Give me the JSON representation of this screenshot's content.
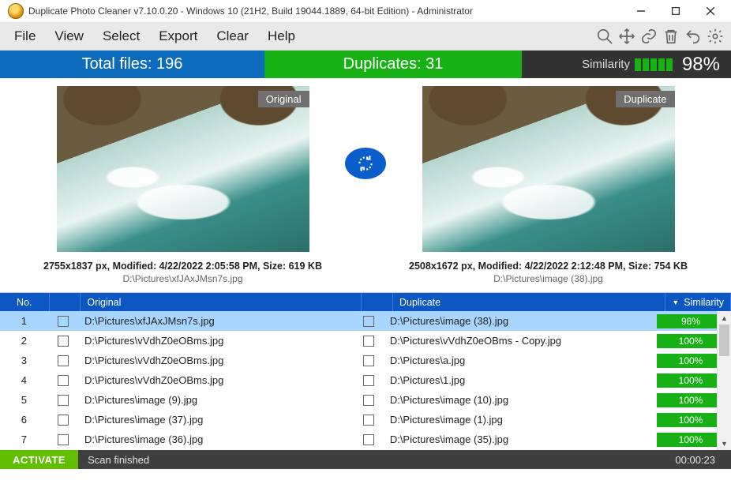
{
  "window": {
    "title": "Duplicate Photo Cleaner v7.10.0.20 - Windows 10 (21H2, Build 19044.1889, 64-bit Edition) - Administrator"
  },
  "menu": {
    "file": "File",
    "view": "View",
    "select": "Select",
    "export": "Export",
    "clear": "Clear",
    "help": "Help"
  },
  "banner": {
    "total_label": "Total files: 196",
    "dup_label": "Duplicates: 31",
    "sim_label": "Similarity",
    "pct": "98%"
  },
  "preview": {
    "left_tag": "Original",
    "right_tag": "Duplicate",
    "left_meta": "2755x1837 px, Modified: 4/22/2022 2:05:58 PM, Size: 619 KB",
    "left_path": "D:\\Pictures\\xfJAxJMsn7s.jpg",
    "right_meta": "2508x1672 px, Modified: 4/22/2022 2:12:48 PM, Size: 754 KB",
    "right_path": "D:\\Pictures\\image (38).jpg"
  },
  "columns": {
    "no": "No.",
    "orig": "Original",
    "dup": "Duplicate",
    "sim": "Similarity"
  },
  "rows": [
    {
      "no": "1",
      "orig": "D:\\Pictures\\xfJAxJMsn7s.jpg",
      "dup": "D:\\Pictures\\image (38).jpg",
      "sim": "98%"
    },
    {
      "no": "2",
      "orig": "D:\\Pictures\\vVdhZ0eOBms.jpg",
      "dup": "D:\\Pictures\\vVdhZ0eOBms - Copy.jpg",
      "sim": "100%"
    },
    {
      "no": "3",
      "orig": "D:\\Pictures\\vVdhZ0eOBms.jpg",
      "dup": "D:\\Pictures\\a.jpg",
      "sim": "100%"
    },
    {
      "no": "4",
      "orig": "D:\\Pictures\\vVdhZ0eOBms.jpg",
      "dup": "D:\\Pictures\\1.jpg",
      "sim": "100%"
    },
    {
      "no": "5",
      "orig": "D:\\Pictures\\image (9).jpg",
      "dup": "D:\\Pictures\\image (10).jpg",
      "sim": "100%"
    },
    {
      "no": "6",
      "orig": "D:\\Pictures\\image (37).jpg",
      "dup": "D:\\Pictures\\image (1).jpg",
      "sim": "100%"
    },
    {
      "no": "7",
      "orig": "D:\\Pictures\\image (36).jpg",
      "dup": "D:\\Pictures\\image (35).jpg",
      "sim": "100%"
    }
  ],
  "status": {
    "activate": "ACTIVATE",
    "msg": "Scan finished",
    "time": "00:00:23"
  }
}
